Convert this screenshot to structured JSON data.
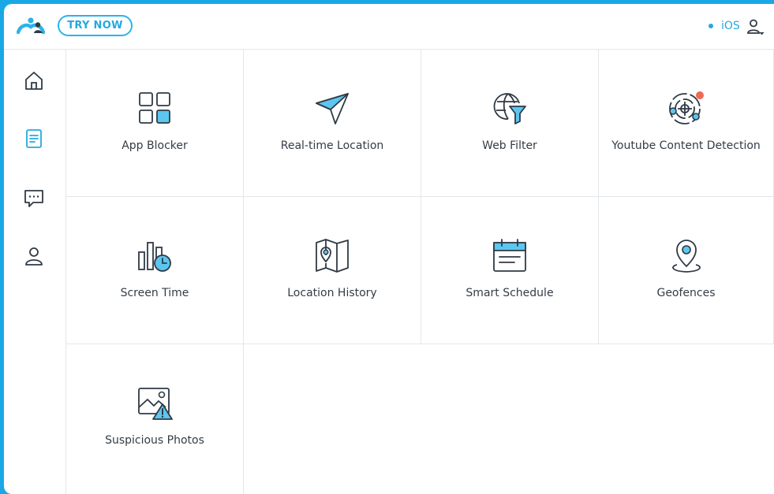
{
  "header": {
    "try_now_label": "TRY NOW",
    "platform_label": "iOS"
  },
  "sidebar": {
    "items": [
      {
        "icon": "home-icon"
      },
      {
        "icon": "document-icon",
        "active": true
      },
      {
        "icon": "message-icon"
      },
      {
        "icon": "user-icon"
      }
    ]
  },
  "features": [
    {
      "label": "App Blocker",
      "icon": "app-blocker-icon"
    },
    {
      "label": "Real-time Location",
      "icon": "paper-plane-icon"
    },
    {
      "label": "Web Filter",
      "icon": "web-filter-icon"
    },
    {
      "label": "Youtube Content Detection",
      "icon": "youtube-detection-icon"
    },
    {
      "label": "Screen Time",
      "icon": "screen-time-icon"
    },
    {
      "label": "Location History",
      "icon": "map-icon"
    },
    {
      "label": "Smart Schedule",
      "icon": "calendar-icon"
    },
    {
      "label": "Geofences",
      "icon": "geofence-pin-icon"
    },
    {
      "label": "Suspicious Photos",
      "icon": "suspicious-photo-icon"
    }
  ],
  "colors": {
    "accent": "#24a9df",
    "frame": "#1aa7e6",
    "icon_fill": "#5cc6ef",
    "icon_stroke": "#2f3a45",
    "alert": "#ee6a55"
  }
}
